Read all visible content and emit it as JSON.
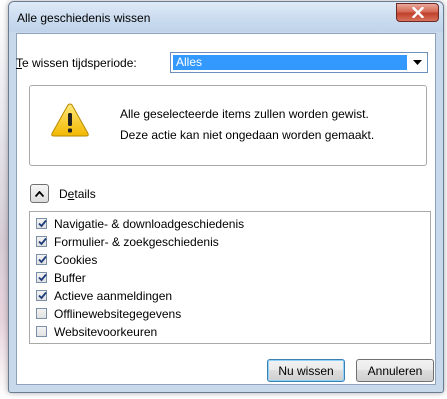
{
  "window": {
    "title": "Alle geschiedenis wissen",
    "close_icon": "close-icon"
  },
  "period": {
    "label_key": "T",
    "label_rest": "e wissen tijdsperiode:",
    "selected": "Alles"
  },
  "warning": {
    "icon": "warning-icon",
    "line1": "Alle geselecteerde items zullen worden gewist.",
    "line2": "Deze actie kan niet ongedaan worden gemaakt."
  },
  "details": {
    "label_first": "D",
    "label_key": "e",
    "label_rest": "tails",
    "toggle_icon": "chevron-up-icon"
  },
  "items": [
    {
      "label": "Navigatie- & downloadgeschiedenis",
      "checked": true
    },
    {
      "label": "Formulier- & zoekgeschiedenis",
      "checked": true
    },
    {
      "label": "Cookies",
      "checked": true
    },
    {
      "label": "Buffer",
      "checked": true
    },
    {
      "label": "Actieve aanmeldingen",
      "checked": true
    },
    {
      "label": "Offlinewebsitegegevens",
      "checked": false
    },
    {
      "label": "Websitevoorkeuren",
      "checked": false
    }
  ],
  "buttons": {
    "clear_label": "Nu wissen",
    "cancel_label": "Annuleren"
  },
  "colors": {
    "selection": "#3399ff",
    "close_button": "#c7432e",
    "frame": "#c9d9ec"
  }
}
